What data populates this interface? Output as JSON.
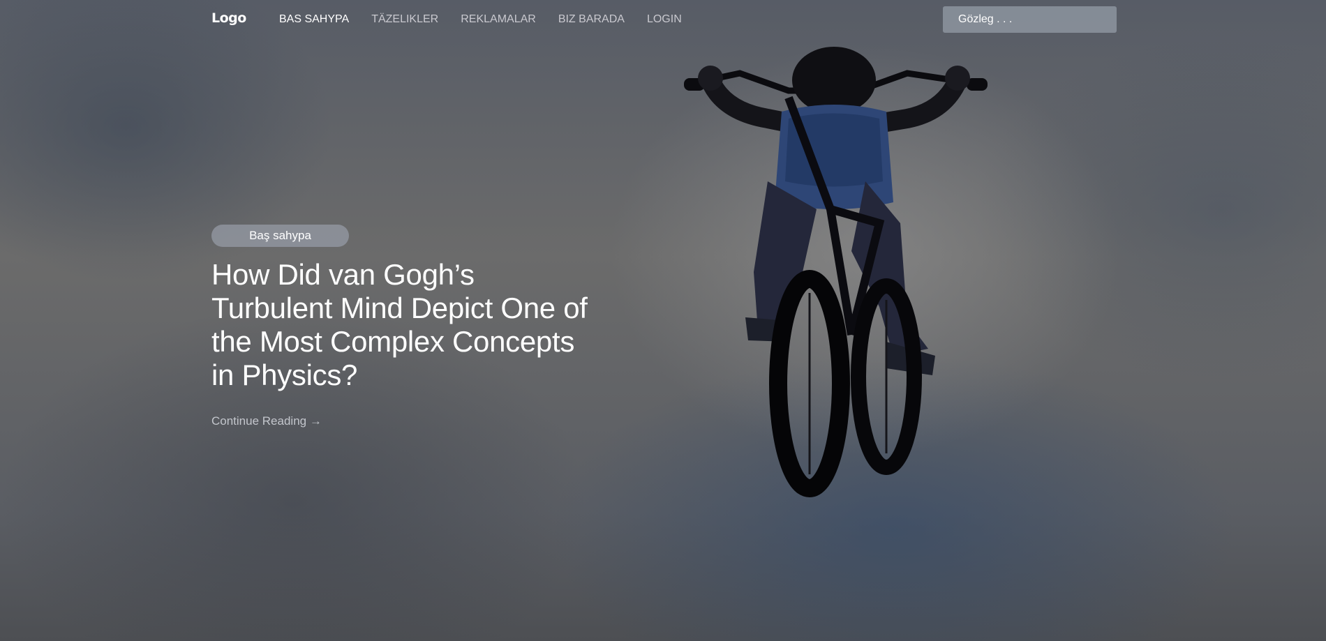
{
  "nav": {
    "logo": "Logo",
    "items": [
      {
        "label": "BAS SAHYPA",
        "active": true
      },
      {
        "label": "TÄZELIKLER",
        "active": false
      },
      {
        "label": "REKLAMALAR",
        "active": false
      },
      {
        "label": "BIZ BARADA",
        "active": false
      },
      {
        "label": "LOGIN",
        "active": false
      }
    ],
    "search_placeholder": "Gözleg . . ."
  },
  "hero": {
    "category": "Baş sahypa",
    "title": "How Did van Gogh’s Turbulent Mind Depict One of the Most Complex Concepts in Physics?",
    "cta": "Continue Reading →"
  },
  "colors": {
    "text": "#ffffff",
    "muted_link": "#c9c9cf",
    "badge_bg": "#969ba5"
  }
}
